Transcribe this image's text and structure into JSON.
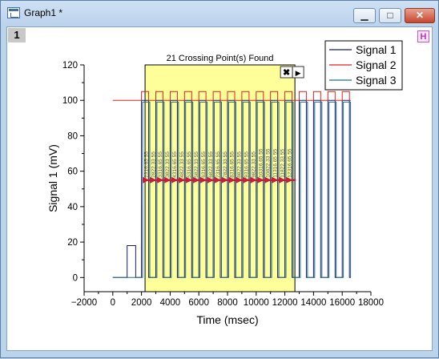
{
  "window": {
    "title": "Graph1 *",
    "minimize_glyph": "▁",
    "maximize_glyph": "□",
    "close_glyph": "✕",
    "layer_label": "1",
    "h_badge": "H"
  },
  "gadget": {
    "label": "21 Crossing Point(s) Found",
    "close_glyph": "✖",
    "menu_glyph": "▶",
    "fill_color": "#ffff99",
    "region_x": [
      2250,
      12700
    ],
    "level_y": 55,
    "crossings": [
      {
        "x": 2316.65,
        "label": "2316.65 55"
      },
      {
        "x": 2822.33,
        "label": "2822.33 55"
      },
      {
        "x": 3316.65,
        "label": "3316.65 55"
      },
      {
        "x": 3822.33,
        "label": "3822.33 55"
      },
      {
        "x": 4316.65,
        "label": "4316.65 55"
      },
      {
        "x": 4822.33,
        "label": "4822.33 55"
      },
      {
        "x": 5316.65,
        "label": "5316.65 55"
      },
      {
        "x": 5822.33,
        "label": "5822.33 55"
      },
      {
        "x": 6316.65,
        "label": "6316.65 55"
      },
      {
        "x": 6822.33,
        "label": "6822.33 55"
      },
      {
        "x": 7316.65,
        "label": "7316.65 55"
      },
      {
        "x": 7822.33,
        "label": "7822.33 55"
      },
      {
        "x": 8316.65,
        "label": "8316.65 55"
      },
      {
        "x": 8822.33,
        "label": "8822.33 55"
      },
      {
        "x": 9316.65,
        "label": "9316.65 55"
      },
      {
        "x": 9822.33,
        "label": "9822.33 55"
      },
      {
        "x": 10316.65,
        "label": "10316.65 55"
      },
      {
        "x": 10822.33,
        "label": "10822.33 55"
      },
      {
        "x": 11316.65,
        "label": "11316.65 55"
      },
      {
        "x": 11822.33,
        "label": "11822.33 55"
      },
      {
        "x": 12316.65,
        "label": "12316.65 55"
      }
    ]
  },
  "chart_data": {
    "type": "line",
    "xlabel": "Time (msec)",
    "ylabel": "Signal 1 (mV)",
    "xlim": [
      -2000,
      18000
    ],
    "ylim": [
      -8,
      120
    ],
    "xticks": [
      -2000,
      0,
      2000,
      4000,
      6000,
      8000,
      10000,
      12000,
      14000,
      16000,
      18000
    ],
    "xtick_labels": [
      "−2000",
      "0",
      "2000",
      "4000",
      "6000",
      "8000",
      "10000",
      "12000",
      "14000",
      "16000",
      "18000"
    ],
    "yticks": [
      0,
      20,
      40,
      60,
      80,
      100,
      120
    ],
    "legend_position": "top-right",
    "series": [
      {
        "name": "Signal 1",
        "color": "#1a1a6e",
        "baseline": 0,
        "high": 100,
        "pulse_start": 2000,
        "period": 1000,
        "duty": 0.5,
        "pulse_end": 16600,
        "pre_pulse": {
          "x0": 1000,
          "x1": 1600,
          "value": 18
        }
      },
      {
        "name": "Signal 2",
        "color": "#e02020",
        "baseline": 100,
        "high": 105,
        "pulse_start": 2000,
        "period": 1000,
        "duty": 0.5,
        "pulse_end": 16600
      },
      {
        "name": "Signal 3",
        "color": "#1c6f8f",
        "baseline": 0,
        "high": 99,
        "pulse_start": 2000,
        "period": 1000,
        "duty": 0.5,
        "pulse_end": 16600
      }
    ]
  }
}
